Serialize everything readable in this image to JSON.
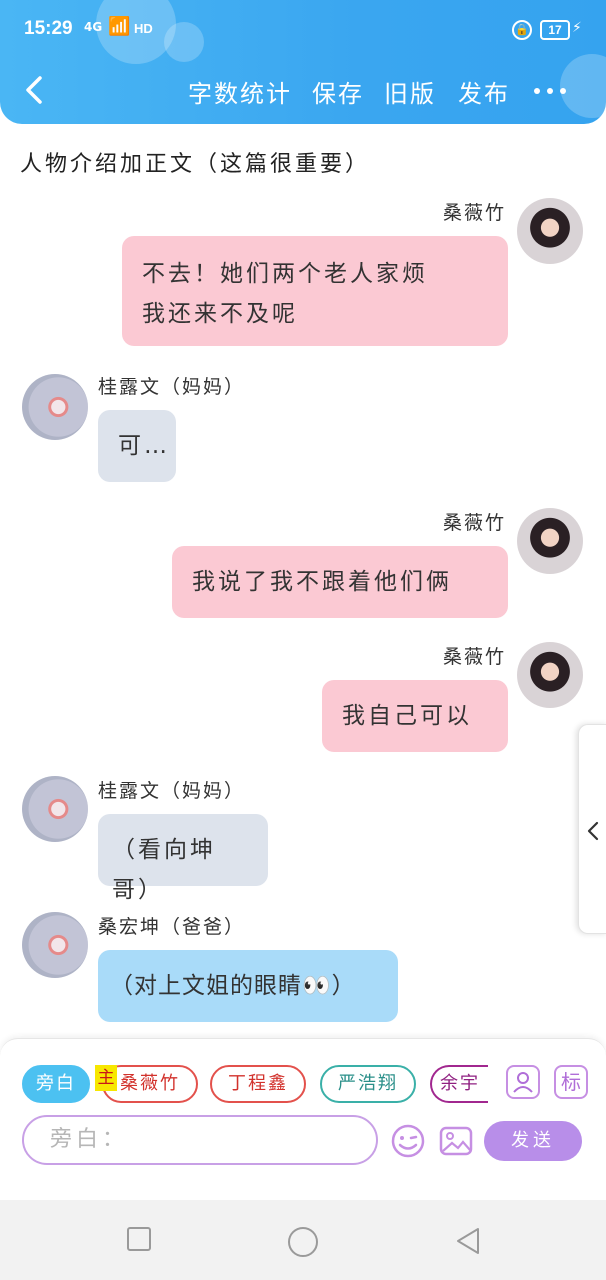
{
  "status_bar": {
    "time": "15:29",
    "network": "4G",
    "hd": "HD",
    "battery": "17"
  },
  "toolbar": {
    "word_count": "字数统计",
    "save": "保存",
    "old_version": "旧版",
    "publish": "发布"
  },
  "chapter_title": "人物介绍加正文（这篇很重要）",
  "messages": [
    {
      "sender": "桑薇竹",
      "text_lines": [
        "不去！她们两个老人家烦",
        "我还来不及呢"
      ]
    },
    {
      "sender": "桂露文（妈妈）",
      "text_lines": [
        "可…"
      ]
    },
    {
      "sender": "桑薇竹",
      "text_lines": [
        "我说了我不跟着他们俩"
      ]
    },
    {
      "sender": "桑薇竹",
      "text_lines": [
        "我自己可以"
      ]
    },
    {
      "sender": "桂露文（妈妈）",
      "text_lines": [
        "（看向坤哥）"
      ]
    },
    {
      "sender": "桑宏坤（爸爸）",
      "text_lines": [
        "（对上文姐的眼睛👀）"
      ]
    }
  ],
  "composer": {
    "roles": [
      "旁白",
      "桑薇竹",
      "丁程鑫",
      "严浩翔",
      "余宇"
    ],
    "main_badge": "主",
    "tag_label": "标",
    "placeholder": "旁白：",
    "send": "发送"
  }
}
